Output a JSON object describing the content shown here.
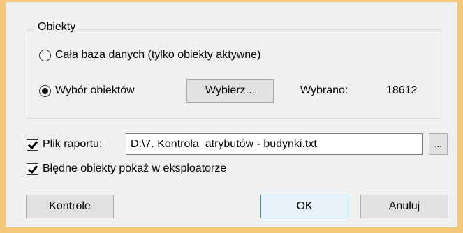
{
  "group": {
    "title": "Obiekty",
    "radio_all_label": "Cała baza danych (tylko obiekty aktywne)",
    "radio_select_label": "Wybór obiektów",
    "select_button_label": "Wybierz...",
    "selected_label": "Wybrano:",
    "selected_count": "18612"
  },
  "report": {
    "checkbox_label": "Plik raportu:",
    "file_path": "D:\\7. Kontrola_atrybutów - budynki.txt",
    "browse_label": "..."
  },
  "explorer": {
    "checkbox_label": "Błędne obiekty pokaż w eksploatorze"
  },
  "buttons": {
    "controls": "Kontrole",
    "ok": "OK",
    "cancel": "Anuluj"
  },
  "colors": {
    "window_border": "#f3c879",
    "dialog_bg": "#f0f0f0",
    "default_button_border": "#3c7fb1"
  }
}
